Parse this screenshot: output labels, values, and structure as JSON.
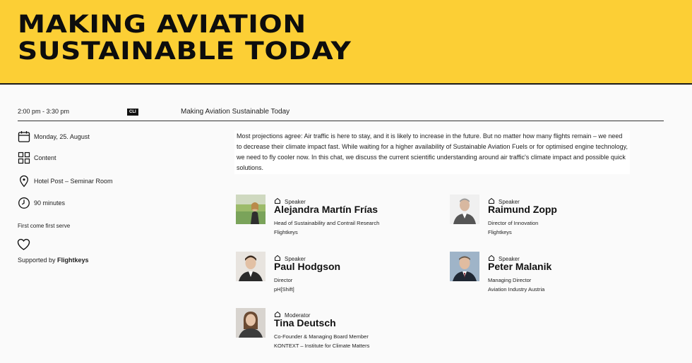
{
  "header": {
    "title_line1": "MAKING AVIATION",
    "title_line2": "SUSTAINABLE TODAY"
  },
  "session": {
    "time": "2:00 pm - 3:30 pm",
    "tag": "CLI",
    "title": "Making Aviation Sustainable Today"
  },
  "sidebar": {
    "date": "Monday, 25. August",
    "category": "Content",
    "location": "Hotel Post – Seminar Room",
    "duration": "90 minutes",
    "admission": "First come first serve",
    "supported_prefix": "Supported by",
    "supporter": "Flightkeys"
  },
  "description": "Most projections agree: Air traffic is here to stay, and it is likely to increase in the future. But no matter how many flights remain – we need to decrease their climate impact fast. While waiting for a higher availability of Sustainable Aviation Fuels or for optimised engine technology, we need to fly cooler now. In this chat, we discuss the current scientific understanding around air traffic's climate impact and possible quick solutions.",
  "people": [
    {
      "role": "Speaker",
      "name": "Alejandra Martín Frías",
      "title": "Head of Sustainability and Contrail Research",
      "org": "Flightkeys"
    },
    {
      "role": "Speaker",
      "name": "Raimund Zopp",
      "title": "Director of Innovation",
      "org": "Flightkeys"
    },
    {
      "role": "Speaker",
      "name": "Paul Hodgson",
      "title": "Director",
      "org": "pH[Shift]"
    },
    {
      "role": "Speaker",
      "name": "Peter Malanik",
      "title": "Managing Director",
      "org": "Aviation Industry Austria"
    },
    {
      "role": "Moderator",
      "name": "Tina Deutsch",
      "title": "Co-Founder & Managing Board Member",
      "org": "KONTEXT – Institute for Climate Matters"
    }
  ],
  "colors": {
    "banner": "#fccf35",
    "text": "#111111",
    "background": "#fafafa"
  },
  "icons": [
    "calendar-icon",
    "grid-icon",
    "location-pin-icon",
    "clock-icon",
    "heart-icon",
    "home-icon"
  ]
}
